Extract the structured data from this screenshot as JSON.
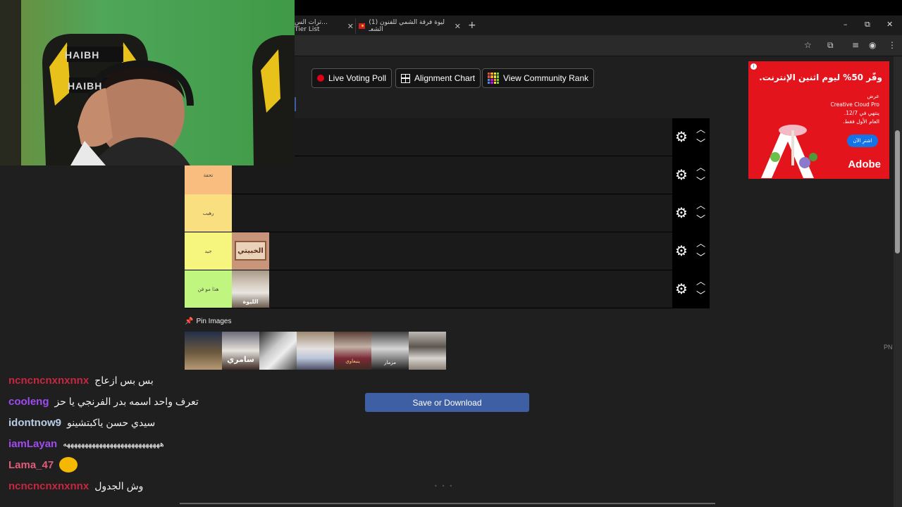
{
  "browser": {
    "tabs": [
      {
        "label": "ترات الس… Tier List"
      },
      {
        "label": "(1) ليوة فرقة الشمي للفنون الشعـ"
      }
    ],
    "new_tab": "+",
    "window_controls": {
      "minimize": "–",
      "maximize": "⧉",
      "close": "✕"
    }
  },
  "toolbar": {
    "live_voting": "Live Voting Poll",
    "alignment_chart": "Alignment Chart",
    "community_rank": "View Community Rank"
  },
  "tiers": [
    {
      "label": "",
      "color": "#1a1a1a"
    },
    {
      "label": "",
      "color": "#1a1a1a"
    },
    {
      "label": "تحفة",
      "color": "#f9bd7f"
    },
    {
      "label": "رهيب",
      "color": "#f9df7f"
    },
    {
      "label": "جيد",
      "color": "#f6f67f"
    },
    {
      "label": "هذا مو فن",
      "color": "#c0f67f"
    }
  ],
  "tier_items": {
    "good": [
      "الخبيتي"
    ],
    "bad": [
      "الليوة"
    ]
  },
  "pin": {
    "label": "Pin Images",
    "items": [
      "",
      "سامري",
      "",
      "",
      "ينبعاوي",
      "مزمار",
      ""
    ]
  },
  "save_button": "Save or Download",
  "ad": {
    "headline": "وفّر 50% ليوم اثنين الإنترنت.",
    "body_lines": [
      "عرض",
      "Creative Cloud Pro",
      "ينتهي في 12/7.",
      "العام الأول فقط."
    ],
    "cta": "اشترِ الآن",
    "brand": "Adobe"
  },
  "chat": [
    {
      "user": "ncncncnxnxnnx",
      "color": "#c8263f",
      "message": "بس بس ازعاج"
    },
    {
      "user": "cooleng",
      "color": "#a04bf0",
      "message": "تعرف واحد اسمه بدر الفرنجي يا حز"
    },
    {
      "user": "idontnow9",
      "color": "#b9cde6",
      "message": "سيدي حسن ياكبتشينو"
    },
    {
      "user": "iamLayan",
      "color": "#a04bf0",
      "message": "هههههههههههههههههههههههههههه"
    },
    {
      "user": "Lama_47",
      "color": "#e05c7a",
      "message": ""
    },
    {
      "user": "ncncncnxnxnnx",
      "color": "#c8263f",
      "message": "وش الجدول"
    }
  ],
  "side_text": "PN",
  "webcam": {
    "chair_brand": "HAIBH"
  }
}
